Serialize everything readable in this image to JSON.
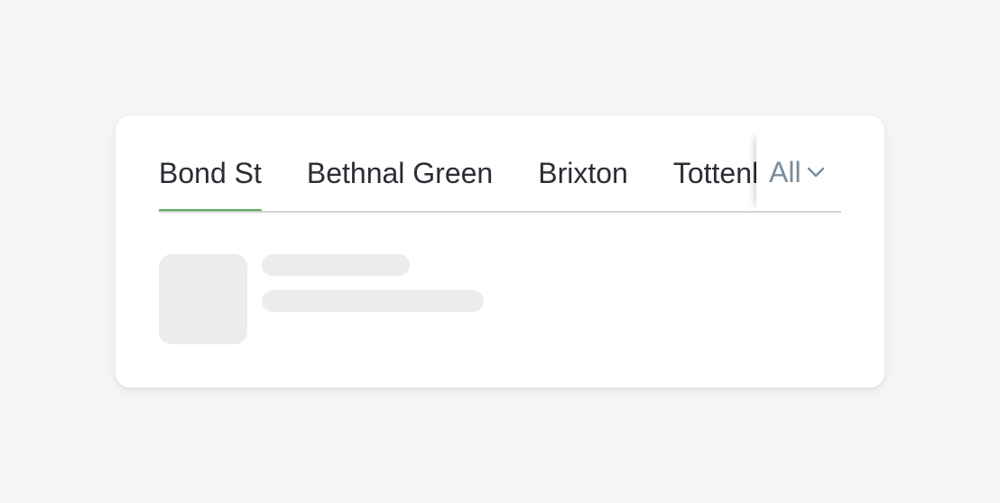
{
  "tabs": {
    "items": [
      {
        "label": "Bond St",
        "active": true
      },
      {
        "label": "Bethnal Green",
        "active": false
      },
      {
        "label": "Brixton",
        "active": false
      },
      {
        "label": "Tottenham",
        "active": false
      }
    ],
    "all_button": {
      "label": "All",
      "icon": "chevron-down-icon"
    }
  },
  "colors": {
    "active_indicator": "#5aa95a",
    "tab_text": "#2a2d33",
    "all_text": "#7a8b99",
    "skeleton": "#ebecee",
    "page_background": "#f5f5f5"
  },
  "content": {
    "state": "loading"
  }
}
